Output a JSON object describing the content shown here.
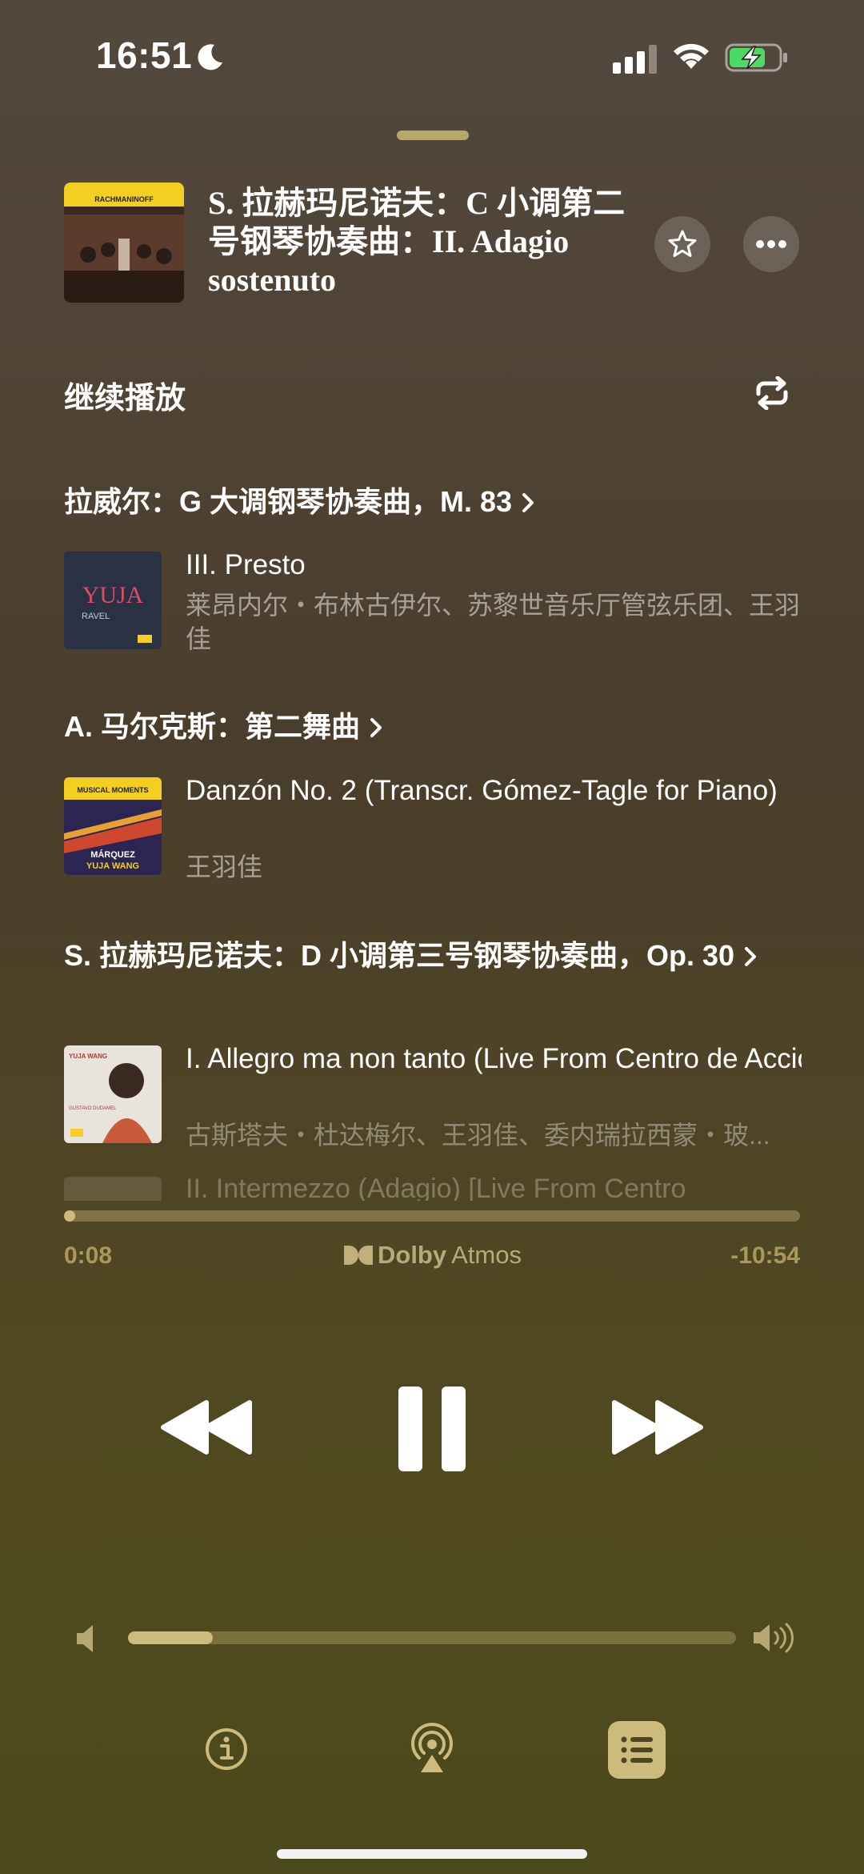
{
  "status_bar": {
    "time": "16:51",
    "icons": [
      "moon-icon",
      "cellular-signal-icon",
      "wifi-icon",
      "battery-charging-icon"
    ]
  },
  "now_playing": {
    "title": "S. 拉赫玛尼诺夫：C 小调第二号钢琴协奏曲：II. Adagio sostenuto",
    "album_art_text": "RACHMANINOFF",
    "favorite_icon": "star-icon",
    "more_icon": "ellipsis-icon"
  },
  "queue": {
    "section_title": "继续播放",
    "repeat_icon": "repeat-icon",
    "groups": [
      {
        "title": "拉威尔：G 大调钢琴协奏曲，M. 83",
        "track_title": "III. Presto",
        "artists": "莱昂内尔・布林古伊尔、苏黎世音乐厅管弦乐团、王羽佳",
        "art_text_main": "YUJA",
        "art_text_sub": "RAVEL"
      },
      {
        "title": "A. 马尔克斯：第二舞曲",
        "track_title": "Danzón No. 2 (Transcr. Gómez-Tagle for Piano)",
        "artists": "王羽佳",
        "art_text_main": "MUSICAL MOMENTS",
        "art_text_sub": "MÁRQUEZ",
        "art_text_sub2": "YUJA WANG"
      },
      {
        "title": "S. 拉赫玛尼诺夫：D 小调第三号钢琴协奏曲，Op. 30",
        "track_title": "I. Allegro ma non tanto (Live From Centro de Acción Social por la Música, Sala Simón...",
        "artists": "古斯塔夫・杜达梅尔、王羽佳、委内瑞拉西蒙・玻...",
        "art_text_main": "YUJA WANG",
        "art_text_sub": "GUSTAVO DUDAMEL"
      }
    ],
    "next_partial": "II. Intermezzo (Adagio) [Live From Centro"
  },
  "playback": {
    "elapsed": "0:08",
    "remaining": "-10:54",
    "progress": 0.012,
    "format_badge_bold": "Dolby",
    "format_badge_light": "Atmos",
    "volume": 0.14
  },
  "controls": {
    "rewind_icon": "backward-icon",
    "pause_icon": "pause-icon",
    "forward_icon": "forward-icon"
  },
  "bottom_bar": {
    "icons": [
      "lyrics-info-icon",
      "airplay-icon",
      "queue-list-icon"
    ]
  },
  "colors": {
    "accent": "#cdbb7d",
    "background_top": "#52483d",
    "background_bottom": "#4b4a1c"
  }
}
